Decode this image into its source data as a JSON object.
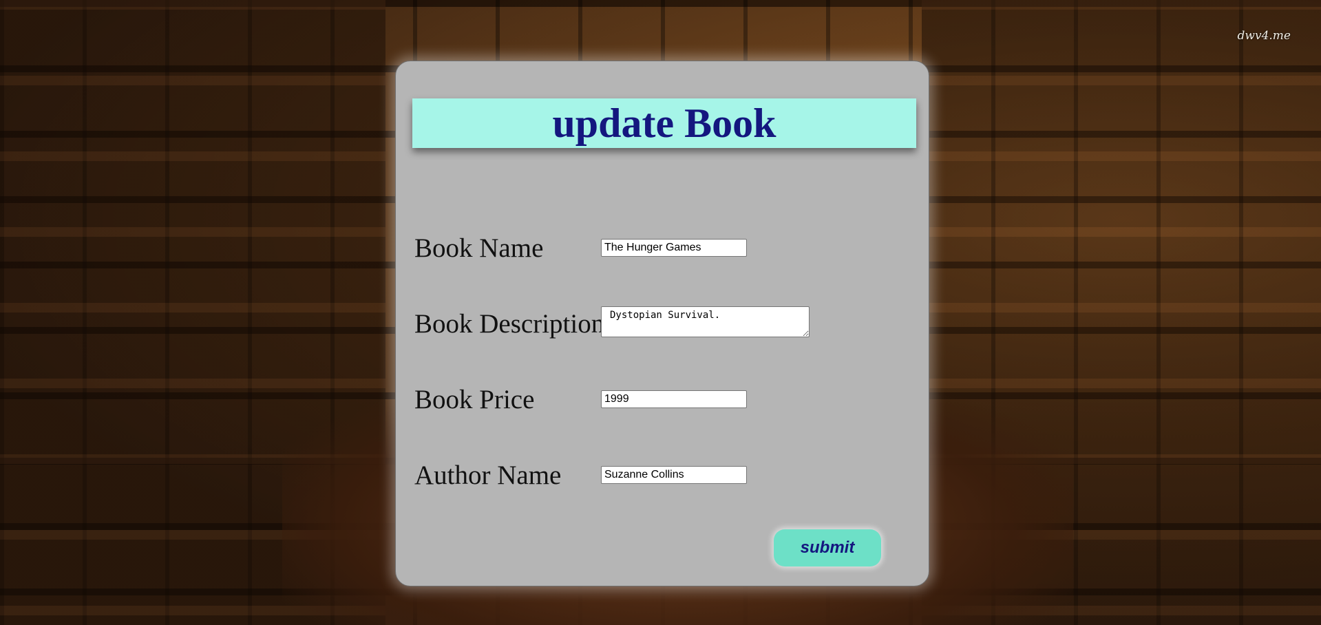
{
  "background": {
    "watermark": "dwv4.me"
  },
  "form": {
    "title": "update Book",
    "fields": [
      {
        "label": "Book Name",
        "value": "The Hunger Games"
      },
      {
        "label": "Book Description",
        "value": "Dystopian Survival."
      },
      {
        "label": "Book Price",
        "value": "1999"
      },
      {
        "label": "Author Name",
        "value": "Suzanne Collins"
      }
    ],
    "submit_label": "submit"
  },
  "colors": {
    "panel": "#b5b5b5",
    "title_bar": "#a6f5e8",
    "title_text": "#14177f",
    "submit_button": "#6de0c7"
  }
}
